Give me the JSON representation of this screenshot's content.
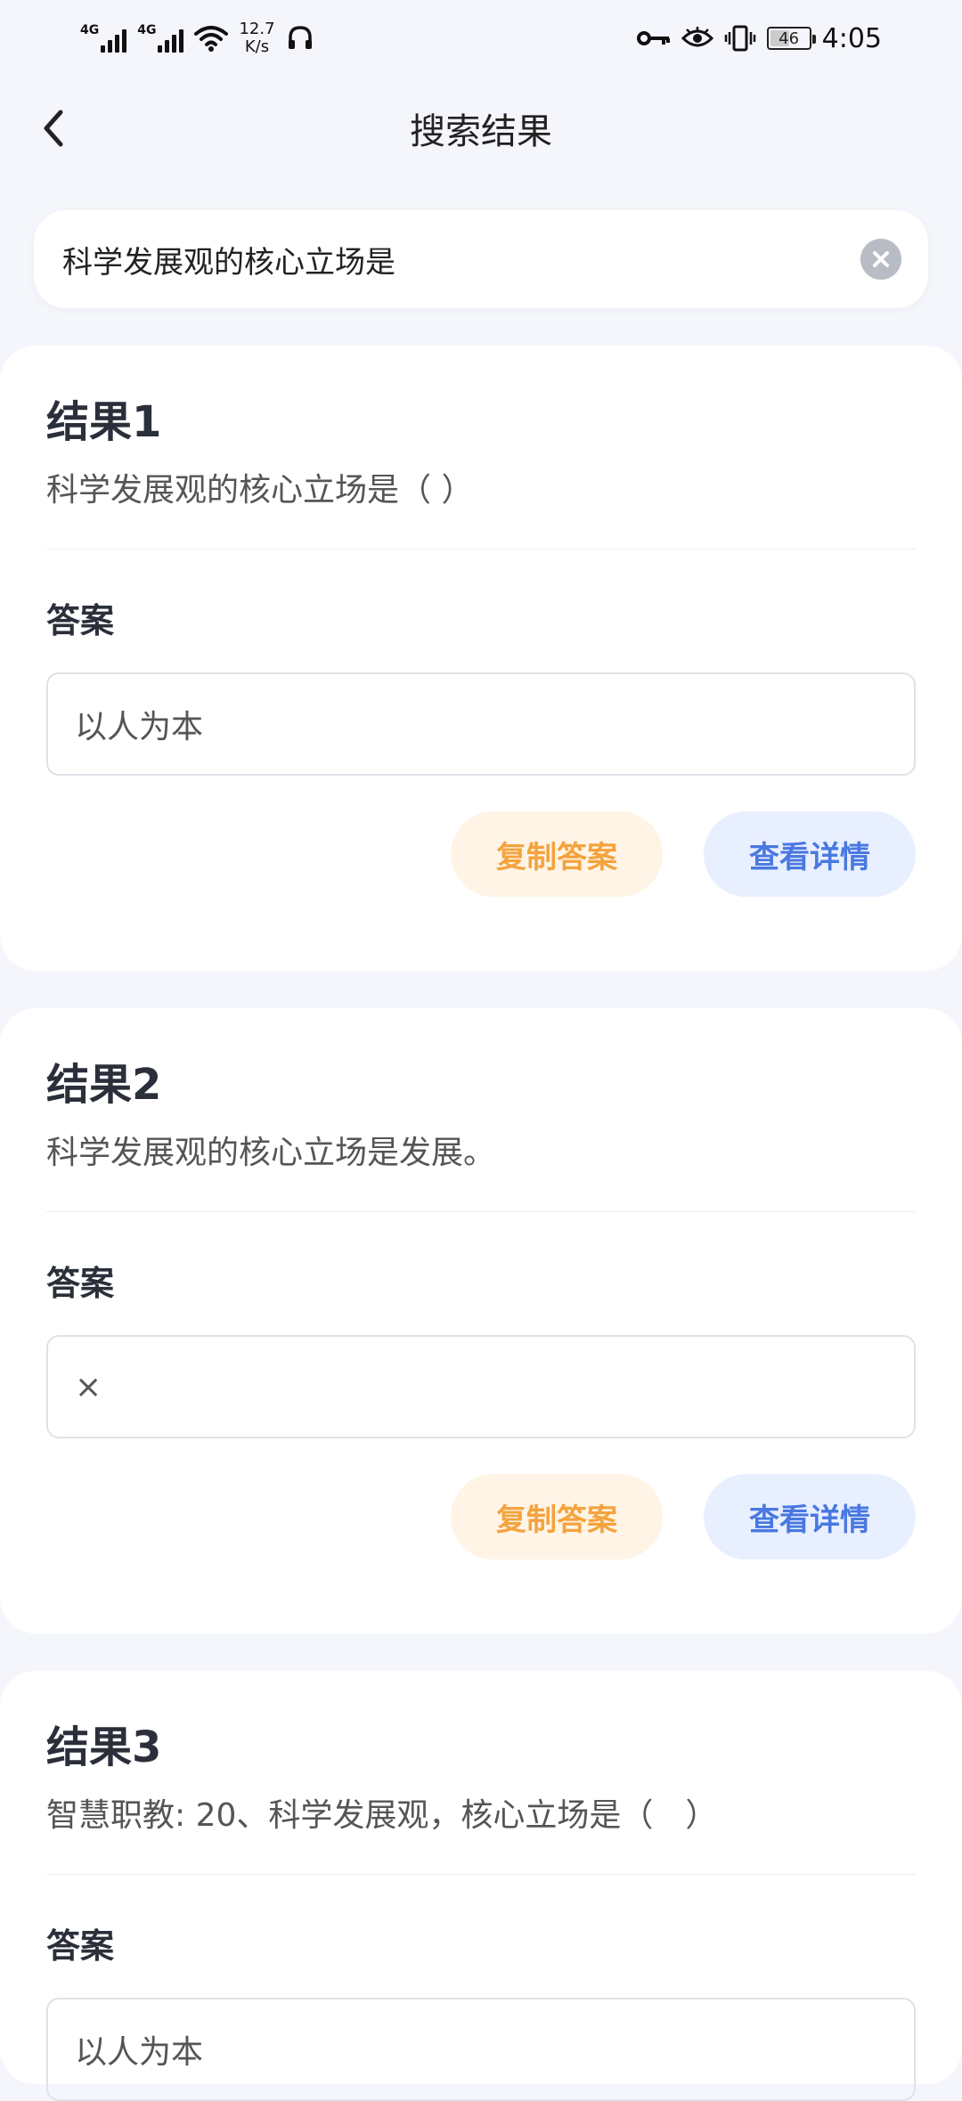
{
  "status_bar": {
    "net1": "4G",
    "net2": "4G",
    "speed_value": "12.7",
    "speed_unit": "K/s",
    "battery": "46",
    "time": "4:05"
  },
  "header": {
    "title": "搜索结果"
  },
  "search": {
    "value": "科学发展观的核心立场是"
  },
  "results": [
    {
      "title": "结果1",
      "question": "科学发展观的核心立场是（ ）",
      "answer_label": "答案",
      "answer": "以人为本",
      "copy_label": "复制答案",
      "detail_label": "查看详情"
    },
    {
      "title": "结果2",
      "question": "科学发展观的核心立场是发展。",
      "answer_label": "答案",
      "answer": "×",
      "copy_label": "复制答案",
      "detail_label": "查看详情"
    },
    {
      "title": "结果3",
      "question": "智慧职教: 20、科学发展观，核心立场是（　）",
      "answer_label": "答案",
      "answer": "以人为本"
    }
  ],
  "colors": {
    "copy_text": "#f4a33e",
    "copy_bg": "#fff4e5",
    "detail_text": "#4a78e0",
    "detail_bg": "#e8efff",
    "page_bg": "#f4f6fb"
  }
}
